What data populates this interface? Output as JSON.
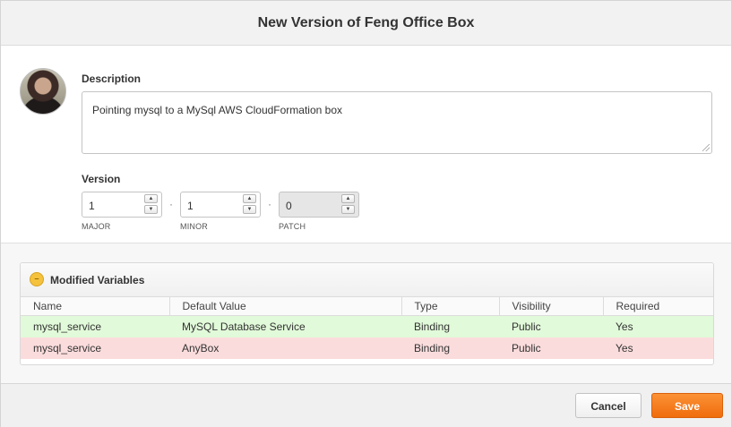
{
  "dialog": {
    "title": "New Version of Feng Office Box"
  },
  "description": {
    "label": "Description",
    "value": "Pointing mysql to a MySql AWS CloudFormation box"
  },
  "version": {
    "label": "Version",
    "separator": "·",
    "major": {
      "value": "1",
      "label": "MAJOR"
    },
    "minor": {
      "value": "1",
      "label": "MINOR"
    },
    "patch": {
      "value": "0",
      "label": "PATCH",
      "disabled": true
    }
  },
  "variables": {
    "title": "Modified Variables",
    "icon": "minus-circle-icon",
    "columns": [
      "Name",
      "Default Value",
      "Type",
      "Visibility",
      "Required"
    ],
    "rows": [
      {
        "status": "added",
        "cells": [
          "mysql_service",
          "MySQL Database Service",
          "Binding",
          "Public",
          "Yes"
        ]
      },
      {
        "status": "removed",
        "cells": [
          "mysql_service",
          "AnyBox",
          "Binding",
          "Public",
          "Yes"
        ]
      }
    ],
    "colors": {
      "added": "#e1fad9",
      "removed": "#fbdcdc"
    }
  },
  "footer": {
    "cancel_label": "Cancel",
    "save_label": "Save",
    "save_color": "#f07d1e"
  }
}
